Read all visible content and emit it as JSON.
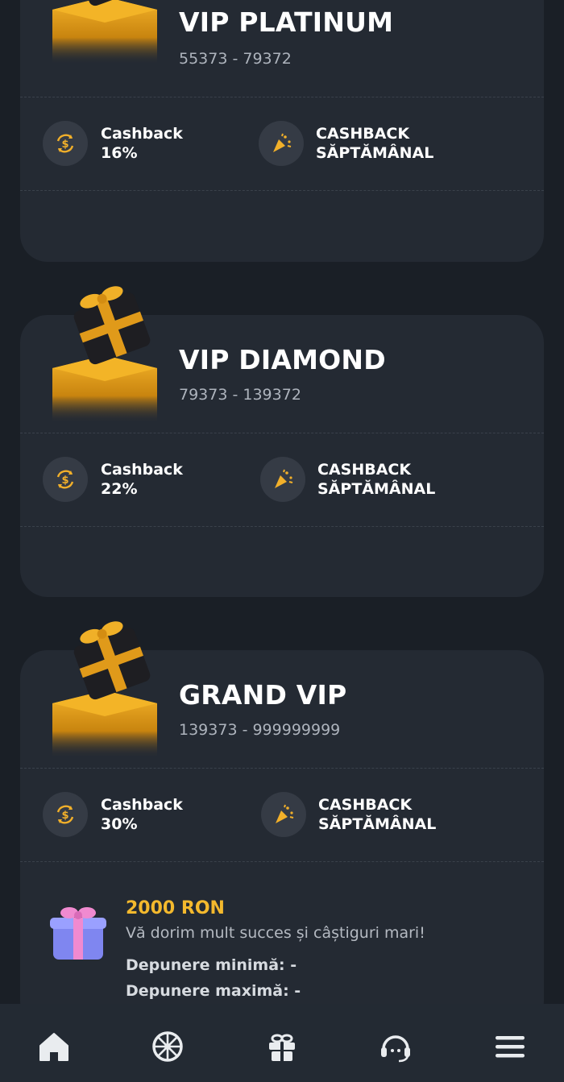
{
  "tiers": [
    {
      "name": "VIP PLATINUM",
      "range": "55373 - 79372",
      "cashback_label": "Cashback",
      "cashback_value": "16%",
      "weekly_line1": "CASHBACK",
      "weekly_line2": "SĂPTĂMÂNAL"
    },
    {
      "name": "VIP DIAMOND",
      "range": "79373 - 139372",
      "cashback_label": "Cashback",
      "cashback_value": "22%",
      "weekly_line1": "CASHBACK",
      "weekly_line2": "SĂPTĂMÂNAL"
    },
    {
      "name": "GRAND VIP",
      "range": "139373 - 999999999",
      "cashback_label": "Cashback",
      "cashback_value": "30%",
      "weekly_line1": "CASHBACK",
      "weekly_line2": "SĂPTĂMÂNAL"
    }
  ],
  "bonus": {
    "amount": "2000 RON",
    "message": "Vă dorim mult succes și câștiguri mari!",
    "min_deposit": "Depunere minimă: -",
    "max_deposit": "Depunere maximă: -"
  },
  "nav": {
    "items": [
      "home-icon",
      "wheel-icon",
      "gift-icon",
      "support-icon",
      "menu-icon"
    ]
  },
  "colors": {
    "background": "#1a1f26",
    "card": "#242a33",
    "accent_gold": "#f4b92d",
    "icon_circle": "#353b45"
  }
}
